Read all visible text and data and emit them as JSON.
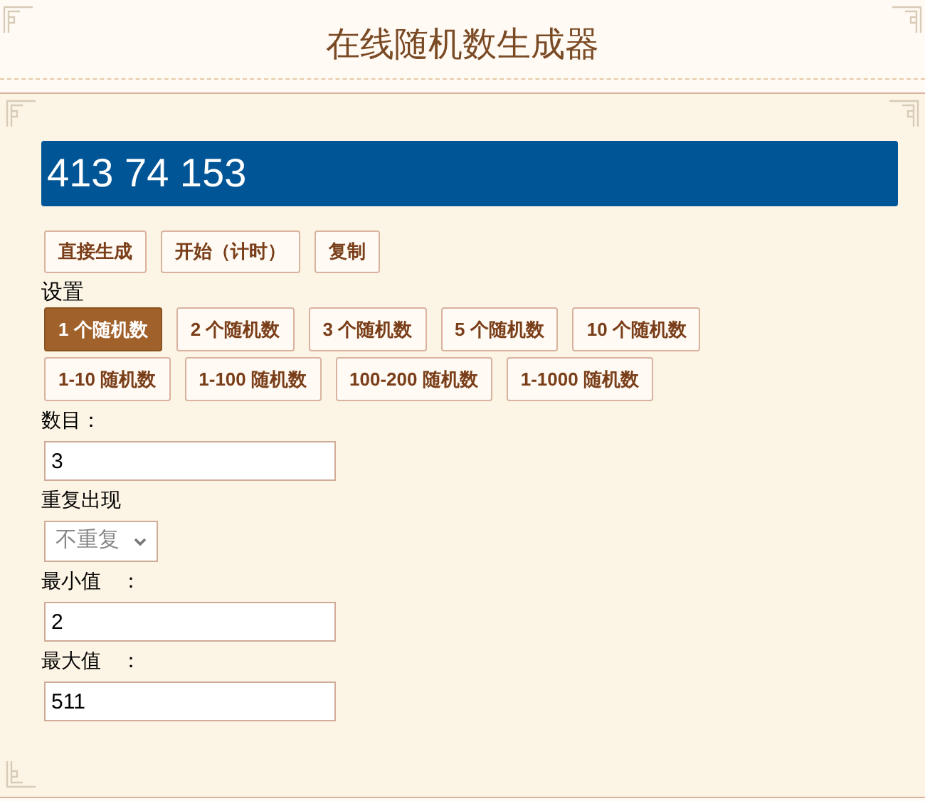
{
  "title": "在线随机数生成器",
  "output": "413 74 153",
  "actions": [
    "直接生成",
    "开始（计时）",
    "复制"
  ],
  "settings_label": "设置",
  "preset_rows": [
    [
      {
        "label": "1 个随机数",
        "selected": true
      },
      {
        "label": "2 个随机数",
        "selected": false
      },
      {
        "label": "3 个随机数",
        "selected": false
      },
      {
        "label": "5 个随机数",
        "selected": false
      },
      {
        "label": "10 个随机数",
        "selected": false
      }
    ],
    [
      {
        "label": "1-10 随机数",
        "selected": false
      },
      {
        "label": "1-100 随机数",
        "selected": false
      },
      {
        "label": "100-200 随机数",
        "selected": false
      },
      {
        "label": "1-1000 随机数",
        "selected": false
      }
    ]
  ],
  "fields": [
    {
      "kind": "input",
      "label": "数目：",
      "value": "3"
    },
    {
      "kind": "select",
      "label": "重复出现",
      "value": "不重复"
    },
    {
      "kind": "input",
      "label": "最小值　：",
      "value": "2"
    },
    {
      "kind": "input",
      "label": "最大值　：",
      "value": "511"
    }
  ]
}
